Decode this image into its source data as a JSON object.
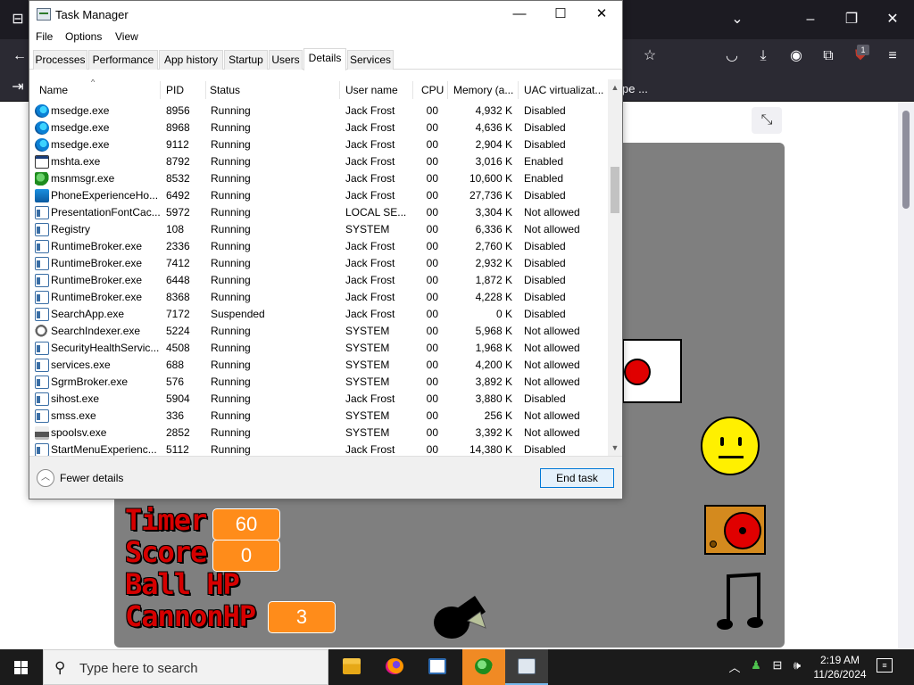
{
  "browser": {
    "badge_count": "1",
    "partial_text": "pe ..."
  },
  "game": {
    "stats": [
      {
        "label": "Timer",
        "value": "60"
      },
      {
        "label": "Score",
        "value": "0"
      },
      {
        "label": "Ball HP",
        "value": ""
      },
      {
        "label": "CannonHP",
        "value": "3"
      }
    ],
    "colors": {
      "label": "#d60000",
      "value_box": "#ff8c1a",
      "background": "#7f7f7f"
    }
  },
  "task_manager": {
    "title": "Task Manager",
    "menu": [
      "File",
      "Options",
      "View"
    ],
    "tabs": [
      "Processes",
      "Performance",
      "App history",
      "Startup",
      "Users",
      "Details",
      "Services"
    ],
    "active_tab": "Details",
    "columns": [
      "Name",
      "PID",
      "Status",
      "User name",
      "CPU",
      "Memory (a...",
      "UAC virtualizat..."
    ],
    "rows": [
      {
        "icon": "edge-icon",
        "name": "msedge.exe",
        "pid": "8956",
        "status": "Running",
        "user": "Jack Frost",
        "cpu": "00",
        "mem": "4,932 K",
        "uac": "Disabled"
      },
      {
        "icon": "edge-icon",
        "name": "msedge.exe",
        "pid": "8968",
        "status": "Running",
        "user": "Jack Frost",
        "cpu": "00",
        "mem": "4,636 K",
        "uac": "Disabled"
      },
      {
        "icon": "edge-icon",
        "name": "msedge.exe",
        "pid": "9112",
        "status": "Running",
        "user": "Jack Frost",
        "cpu": "00",
        "mem": "2,904 K",
        "uac": "Disabled"
      },
      {
        "icon": "hta-icon",
        "name": "mshta.exe",
        "pid": "8792",
        "status": "Running",
        "user": "Jack Frost",
        "cpu": "00",
        "mem": "3,016 K",
        "uac": "Enabled"
      },
      {
        "icon": "msn-icon",
        "name": "msnmsgr.exe",
        "pid": "8532",
        "status": "Running",
        "user": "Jack Frost",
        "cpu": "00",
        "mem": "10,600 K",
        "uac": "Enabled"
      },
      {
        "icon": "phone-icon",
        "name": "PhoneExperienceHo...",
        "pid": "6492",
        "status": "Running",
        "user": "Jack Frost",
        "cpu": "00",
        "mem": "27,736 K",
        "uac": "Disabled"
      },
      {
        "icon": "app-icon",
        "name": "PresentationFontCac...",
        "pid": "5972",
        "status": "Running",
        "user": "LOCAL SE...",
        "cpu": "00",
        "mem": "3,304 K",
        "uac": "Not allowed"
      },
      {
        "icon": "app-icon",
        "name": "Registry",
        "pid": "108",
        "status": "Running",
        "user": "SYSTEM",
        "cpu": "00",
        "mem": "6,336 K",
        "uac": "Not allowed"
      },
      {
        "icon": "app-icon",
        "name": "RuntimeBroker.exe",
        "pid": "2336",
        "status": "Running",
        "user": "Jack Frost",
        "cpu": "00",
        "mem": "2,760 K",
        "uac": "Disabled"
      },
      {
        "icon": "app-icon",
        "name": "RuntimeBroker.exe",
        "pid": "7412",
        "status": "Running",
        "user": "Jack Frost",
        "cpu": "00",
        "mem": "2,932 K",
        "uac": "Disabled"
      },
      {
        "icon": "app-icon",
        "name": "RuntimeBroker.exe",
        "pid": "6448",
        "status": "Running",
        "user": "Jack Frost",
        "cpu": "00",
        "mem": "1,872 K",
        "uac": "Disabled"
      },
      {
        "icon": "app-icon",
        "name": "RuntimeBroker.exe",
        "pid": "8368",
        "status": "Running",
        "user": "Jack Frost",
        "cpu": "00",
        "mem": "4,228 K",
        "uac": "Disabled"
      },
      {
        "icon": "app-icon",
        "name": "SearchApp.exe",
        "pid": "7172",
        "status": "Suspended",
        "user": "Jack Frost",
        "cpu": "00",
        "mem": "0 K",
        "uac": "Disabled"
      },
      {
        "icon": "search-indexer-icon",
        "name": "SearchIndexer.exe",
        "pid": "5224",
        "status": "Running",
        "user": "SYSTEM",
        "cpu": "00",
        "mem": "5,968 K",
        "uac": "Not allowed"
      },
      {
        "icon": "app-icon",
        "name": "SecurityHealthServic...",
        "pid": "4508",
        "status": "Running",
        "user": "SYSTEM",
        "cpu": "00",
        "mem": "1,968 K",
        "uac": "Not allowed"
      },
      {
        "icon": "app-icon",
        "name": "services.exe",
        "pid": "688",
        "status": "Running",
        "user": "SYSTEM",
        "cpu": "00",
        "mem": "4,200 K",
        "uac": "Not allowed"
      },
      {
        "icon": "app-icon",
        "name": "SgrmBroker.exe",
        "pid": "576",
        "status": "Running",
        "user": "SYSTEM",
        "cpu": "00",
        "mem": "3,892 K",
        "uac": "Not allowed"
      },
      {
        "icon": "app-icon",
        "name": "sihost.exe",
        "pid": "5904",
        "status": "Running",
        "user": "Jack Frost",
        "cpu": "00",
        "mem": "3,880 K",
        "uac": "Disabled"
      },
      {
        "icon": "app-icon",
        "name": "smss.exe",
        "pid": "336",
        "status": "Running",
        "user": "SYSTEM",
        "cpu": "00",
        "mem": "256 K",
        "uac": "Not allowed"
      },
      {
        "icon": "printer-icon",
        "name": "spoolsv.exe",
        "pid": "2852",
        "status": "Running",
        "user": "SYSTEM",
        "cpu": "00",
        "mem": "3,392 K",
        "uac": "Not allowed"
      },
      {
        "icon": "app-icon",
        "name": "StartMenuExperienc...",
        "pid": "5112",
        "status": "Running",
        "user": "Jack Frost",
        "cpu": "00",
        "mem": "14,380 K",
        "uac": "Disabled"
      }
    ],
    "fewer_details": "Fewer details",
    "end_task": "End task"
  },
  "taskbar": {
    "search_placeholder": "Type here to search",
    "time": "2:19 AM",
    "date": "11/26/2024",
    "apps": [
      "file-explorer-icon",
      "firefox-icon",
      "app-window-icon",
      "msn-messenger-icon",
      "task-manager-icon"
    ]
  }
}
